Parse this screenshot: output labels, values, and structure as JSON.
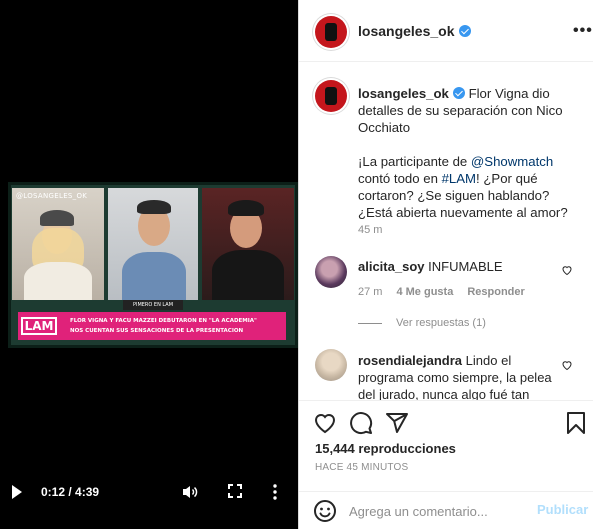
{
  "video": {
    "overlay_handle": "@LOSANGELES_OK",
    "lower_tag": "PIMERO EN LAM",
    "banner_logo": "LAM",
    "banner_line1": "FLOR VIGNA Y FACU MAZZEI DEBUTARON EN \"LA ACADEMIA\"",
    "banner_line2": "NOS CUENTAN SUS SENSACIONES DE LA PRESENTACION",
    "time": "0:12 / 4:39",
    "progress": 0.043,
    "icons": [
      "play-icon",
      "volume-icon",
      "fullscreen-icon",
      "more-vertical-icon"
    ]
  },
  "header": {
    "username": "losangeles_ok",
    "verified": true,
    "more": "•••"
  },
  "caption": {
    "username": "losangeles_ok",
    "line1": "Flor Vigna dio detalles de su separación con Nico Occhiato",
    "pre_mention": "¡La participante de ",
    "mention": "@Showmatch",
    "mid": " contó todo en ",
    "hashtag": "#LAM",
    "rest": "! ¿Por qué cortaron? ¿Se siguen hablando? ¿Está abierta nuevamente al amor?",
    "time": "45 m"
  },
  "comments": [
    {
      "username": "alicita_soy",
      "text": "INFUMABLE",
      "time": "27 m",
      "likes": "4 Me gusta",
      "reply": "Responder",
      "view_replies": "Ver respuestas (1)"
    },
    {
      "username": "rosendialejandra",
      "text": "Lindo el programa como siempre, la pelea del jurado, nunca algo fué tan"
    }
  ],
  "stats": {
    "views": "15,444 reproducciones",
    "ago": "HACE 45 MINUTOS"
  },
  "composer": {
    "placeholder": "Agrega un comentario...",
    "post": "Publicar"
  },
  "colors": {
    "accent": "#3897f0",
    "brand_red": "#c4161c",
    "banner_pink": "#e0227a",
    "post_disabled": "#b2dffc"
  }
}
